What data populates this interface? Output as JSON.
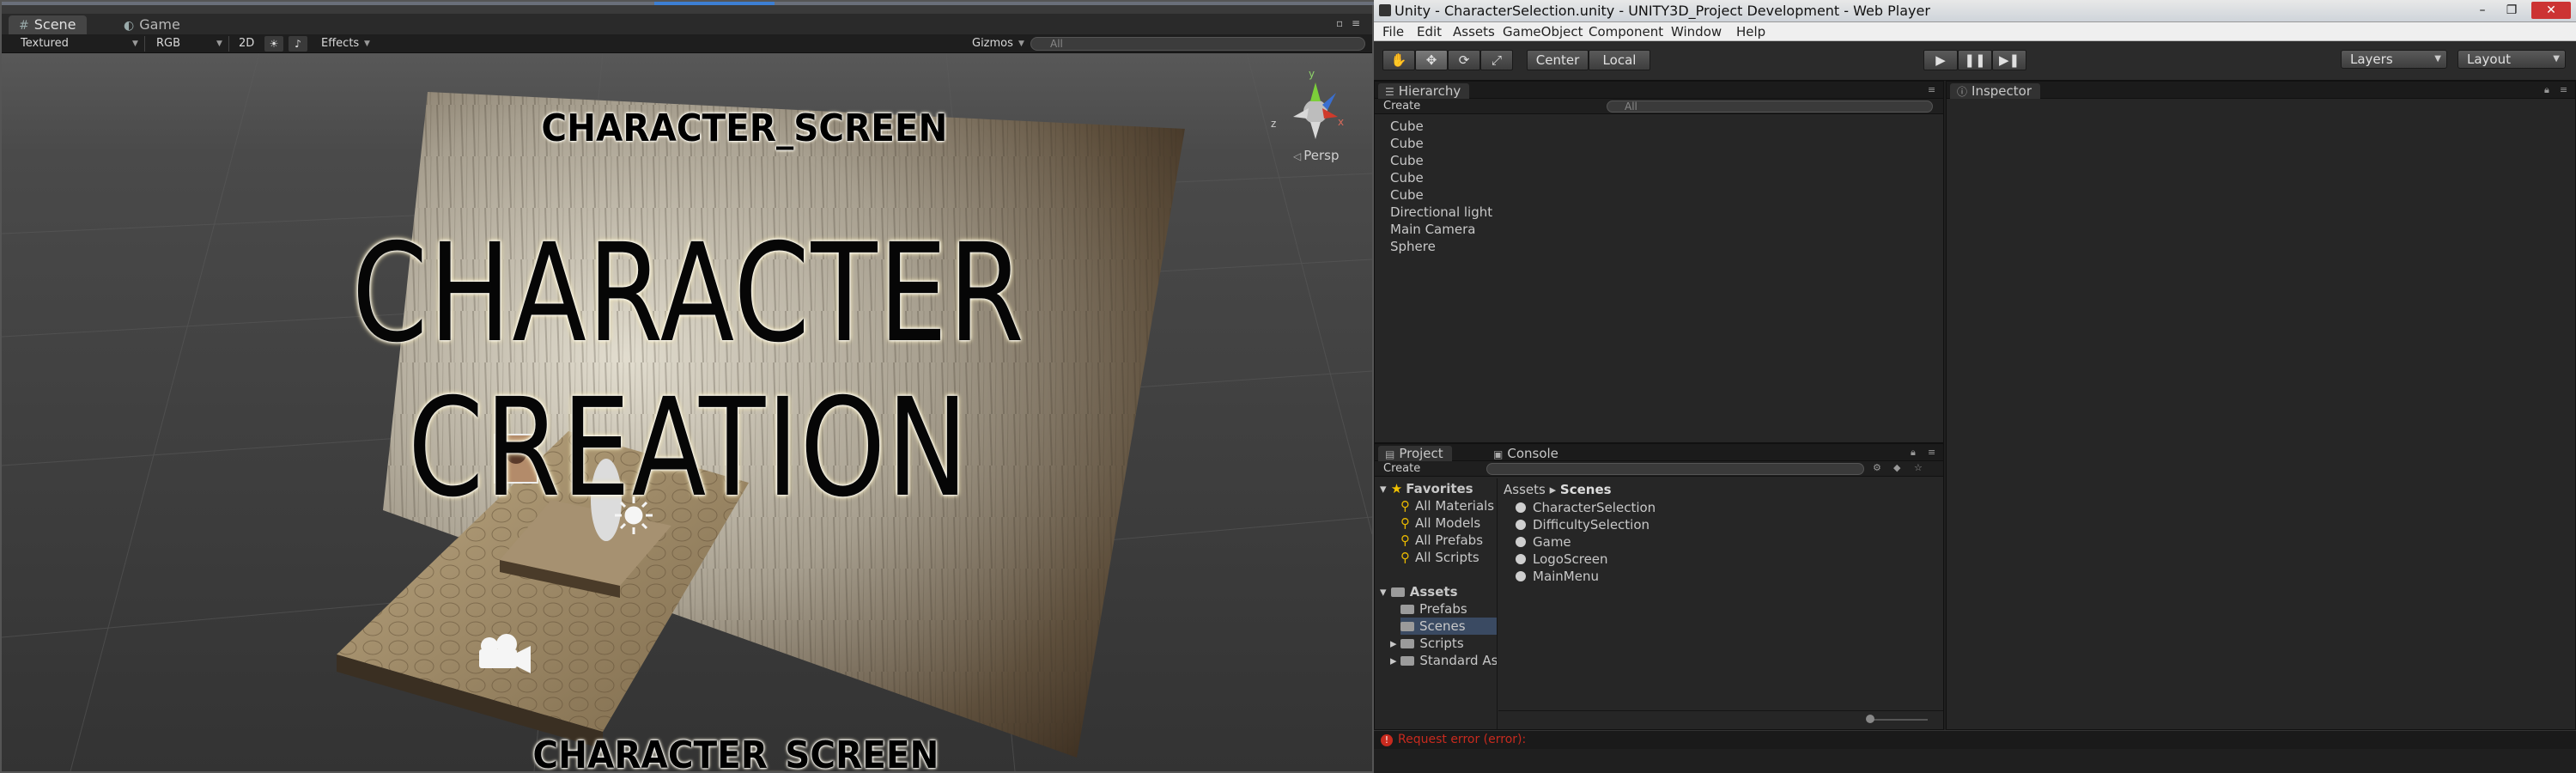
{
  "scene_window": {
    "tabs": [
      {
        "label": "Scene",
        "icon": "grid-icon",
        "active": true
      },
      {
        "label": "Game",
        "icon": "pacman-icon",
        "active": false
      }
    ],
    "toolbar": {
      "render_mode": "Textured",
      "color_mode": "RGB",
      "mode_2d": "2D",
      "lighting_toggle": "☀",
      "audio_toggle": "♪",
      "effects": "Effects",
      "gizmos": "Gizmos",
      "search_placeholder": "All"
    },
    "viewport": {
      "subtitle_top": "CHARACTER_SCREEN",
      "title": "CHARACTER CREATION",
      "subtitle_bottom": "CHARACTER_SCREEN",
      "persp_label": "Persp"
    }
  },
  "editor": {
    "title": "Unity - CharacterSelection.unity - UNITY3D_Project Development - Web Player",
    "window_buttons": [
      "–",
      "❐",
      "✕"
    ],
    "menu": [
      "File",
      "Edit",
      "Assets",
      "GameObject",
      "Component",
      "Window",
      "Help"
    ],
    "toolbar": {
      "tools": [
        "hand-icon",
        "move-icon",
        "rotate-icon",
        "scale-icon"
      ],
      "pivot": "Center",
      "space": "Local",
      "play_buttons": [
        "▶",
        "❚❚",
        "▶❚"
      ],
      "layers": "Layers",
      "layout": "Layout"
    },
    "hierarchy": {
      "tab": "Hierarchy",
      "create": "Create",
      "search_placeholder": "All",
      "items": [
        "Cube",
        "Cube",
        "Cube",
        "Cube",
        "Cube",
        "Directional light",
        "Main Camera",
        "Sphere"
      ]
    },
    "inspector": {
      "tab": "Inspector"
    },
    "project": {
      "tabs": [
        "Project",
        "Console"
      ],
      "create": "Create",
      "favorites": {
        "label": "Favorites",
        "items": [
          "All Materials",
          "All Models",
          "All Prefabs",
          "All Scripts"
        ]
      },
      "assets": {
        "label": "Assets",
        "items": [
          "Prefabs",
          "Scenes",
          "Scripts",
          "Standard As"
        ]
      },
      "breadcrumb": {
        "root": "Assets",
        "sep": "▸",
        "current": "Scenes"
      },
      "files": [
        "CharacterSelection",
        "DifficultySelection",
        "Game",
        "LogoScreen",
        "MainMenu"
      ]
    },
    "status": {
      "message": "Request error (error):",
      "color": "#c82a1e"
    }
  }
}
